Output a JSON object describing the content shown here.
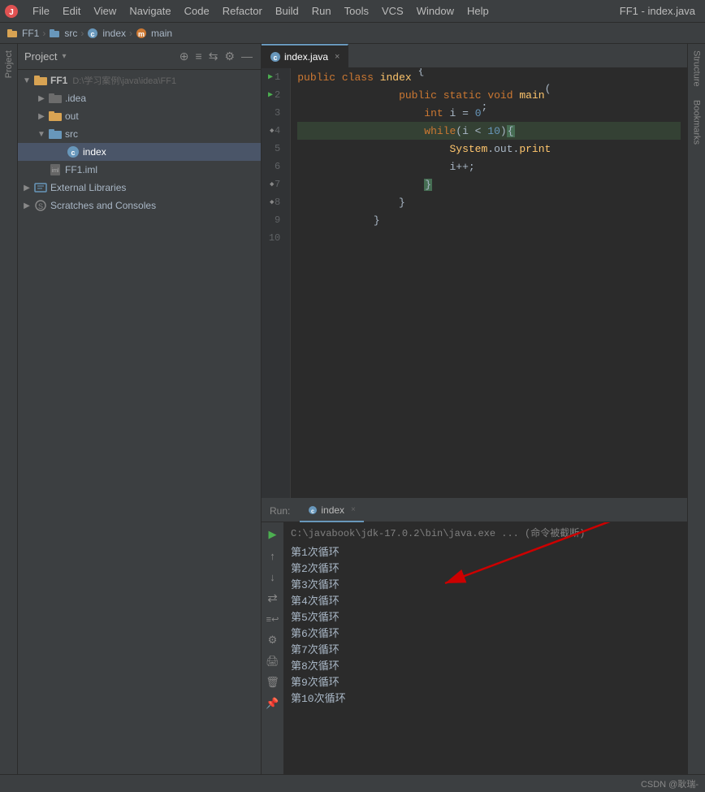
{
  "menu": {
    "logo": "🔴",
    "items": [
      "File",
      "Edit",
      "View",
      "Navigate",
      "Code",
      "Refactor",
      "Build",
      "Run",
      "Tools",
      "VCS",
      "Window",
      "Help"
    ],
    "right_title": "FF1 - index.java"
  },
  "breadcrumb": {
    "items": [
      "FF1",
      "src",
      "index",
      "main"
    ]
  },
  "project_panel": {
    "title": "Project",
    "toolbar_icons": [
      "⊕",
      "≡",
      "⇆",
      "⚙",
      "—"
    ],
    "tree": [
      {
        "level": 0,
        "icon": "folder",
        "label": "FF1",
        "extra": "D:\\学习案例\\java\\idea\\FF1",
        "expanded": true,
        "arrow": "▼"
      },
      {
        "level": 1,
        "icon": "folder-hidden",
        "label": ".idea",
        "expanded": false,
        "arrow": "▶"
      },
      {
        "level": 1,
        "icon": "folder-out",
        "label": "out",
        "expanded": false,
        "arrow": "▶"
      },
      {
        "level": 1,
        "icon": "folder-src",
        "label": "src",
        "expanded": true,
        "arrow": "▼"
      },
      {
        "level": 2,
        "icon": "java-class",
        "label": "index",
        "selected": true,
        "arrow": ""
      },
      {
        "level": 1,
        "icon": "iml",
        "label": "FF1.iml",
        "arrow": ""
      },
      {
        "level": 0,
        "icon": "extlib",
        "label": "External Libraries",
        "expanded": false,
        "arrow": "▶"
      },
      {
        "level": 0,
        "icon": "scratch",
        "label": "Scratches and Consoles",
        "expanded": false,
        "arrow": "▶"
      }
    ]
  },
  "editor": {
    "tabs": [
      {
        "label": "index.java",
        "icon": "java",
        "active": true,
        "closeable": true
      }
    ],
    "code_lines": [
      {
        "num": 1,
        "has_run": true,
        "content": "public class index {",
        "tokens": [
          {
            "t": "kw",
            "v": "public"
          },
          {
            "t": "sp",
            "v": " "
          },
          {
            "t": "kw",
            "v": "class"
          },
          {
            "t": "sp",
            "v": " "
          },
          {
            "t": "cn",
            "v": "index"
          },
          {
            "t": "sp",
            "v": " {"
          }
        ]
      },
      {
        "num": 2,
        "has_run": true,
        "has_bookmark": true,
        "content": "    public static void main(",
        "tokens": [
          {
            "t": "sp",
            "v": "    "
          },
          {
            "t": "kw",
            "v": "public"
          },
          {
            "t": "sp",
            "v": " "
          },
          {
            "t": "kw",
            "v": "static"
          },
          {
            "t": "sp",
            "v": " "
          },
          {
            "t": "kw",
            "v": "void"
          },
          {
            "t": "sp",
            "v": " "
          },
          {
            "t": "fn",
            "v": "main"
          },
          {
            "t": "sp",
            "v": "("
          }
        ]
      },
      {
        "num": 3,
        "content": "        int i = 0;",
        "tokens": [
          {
            "t": "sp",
            "v": "        "
          },
          {
            "t": "kw",
            "v": "int"
          },
          {
            "t": "sp",
            "v": " i = "
          },
          {
            "t": "num",
            "v": "0"
          },
          {
            "t": "sp",
            "v": ";"
          }
        ]
      },
      {
        "num": 4,
        "has_bookmark": true,
        "highlight": true,
        "content": "        while(i < 10){",
        "tokens": [
          {
            "t": "sp",
            "v": "        "
          },
          {
            "t": "kw",
            "v": "while"
          },
          {
            "t": "sp",
            "v": "(i < "
          },
          {
            "t": "num",
            "v": "10"
          },
          {
            "t": "sp",
            "v": "){"
          },
          {
            "t": "bracket",
            "v": "{"
          }
        ]
      },
      {
        "num": 5,
        "content": "            System.out.print",
        "tokens": [
          {
            "t": "sp",
            "v": "            "
          },
          {
            "t": "cn",
            "v": "System"
          },
          {
            "t": "sp",
            "v": "."
          },
          {
            "t": "var",
            "v": "out"
          },
          {
            "t": "sp",
            "v": "."
          },
          {
            "t": "fn",
            "v": "print"
          }
        ]
      },
      {
        "num": 6,
        "content": "            i++;",
        "tokens": [
          {
            "t": "sp",
            "v": "            "
          },
          {
            "t": "sp",
            "v": "i++;"
          }
        ]
      },
      {
        "num": 7,
        "has_bookmark": true,
        "content": "        }",
        "tokens": [
          {
            "t": "sp",
            "v": "        "
          },
          {
            "t": "bracket-close",
            "v": "}"
          }
        ]
      },
      {
        "num": 8,
        "has_bookmark": true,
        "content": "    }",
        "tokens": [
          {
            "t": "sp",
            "v": "    }"
          }
        ]
      },
      {
        "num": 9,
        "content": "}",
        "tokens": [
          {
            "t": "sp",
            "v": "}"
          }
        ]
      },
      {
        "num": 10,
        "content": "",
        "tokens": []
      }
    ]
  },
  "run_panel": {
    "label": "Run:",
    "tab_label": "index",
    "header_text": "C:\\javabook\\jdk-17.0.2\\bin\\java.exe ... (命令被截断)",
    "output_lines": [
      "第1次循环",
      "第2次循环",
      "第3次循环",
      "第4次循环",
      "第5次循环",
      "第6次循环",
      "第7次循环",
      "第8次循环",
      "第9次循环",
      "第10次循环"
    ]
  },
  "sidebar_labels": {
    "project": "Project",
    "structure": "Structure",
    "bookmarks": "Bookmarks"
  },
  "status_bar": {
    "credit": "CSDN @耿瑞-"
  },
  "icons": {
    "play": "▶",
    "up": "↑",
    "down": "↓",
    "rerun": "↺",
    "stop": "■",
    "settings": "⚙",
    "wrench": "🔧",
    "pin": "📌",
    "close_x": "×"
  }
}
